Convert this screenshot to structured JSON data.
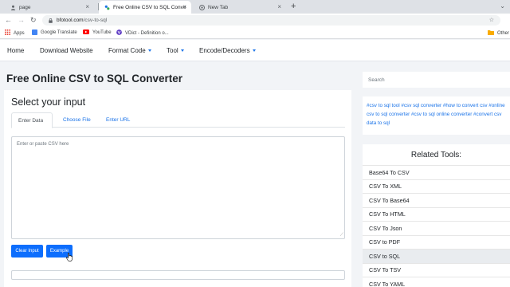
{
  "browser": {
    "tabs": [
      {
        "title": "page"
      },
      {
        "title": "Free Online CSV to SQL Converte"
      },
      {
        "title": "New Tab"
      }
    ],
    "url_domain": "bfotool.com",
    "url_path": "/csv-to-sql",
    "bookmarks": [
      {
        "label": "Apps",
        "color": "#ea4335"
      },
      {
        "label": "Google Translate",
        "color": "#4285f4"
      },
      {
        "label": "YouTube",
        "color": "#ff0000"
      },
      {
        "label": "VDict - Definition o...",
        "color": "#5f3dc4"
      },
      {
        "label": "Other",
        "color": "#f9ab00"
      }
    ]
  },
  "nav": {
    "items": [
      {
        "label": "Home"
      },
      {
        "label": "Download Website"
      },
      {
        "label": "Format Code"
      },
      {
        "label": "Tool"
      },
      {
        "label": "Encode/Decoders"
      }
    ]
  },
  "main": {
    "title": "Free Online CSV to SQL Converter",
    "select_heading": "Select your input",
    "tabs": [
      {
        "label": "Enter Data"
      },
      {
        "label": "Choose File"
      },
      {
        "label": "Enter URL"
      }
    ],
    "textarea_placeholder": "Enter or paste CSV here",
    "clear_label": "Clear Input",
    "example_label": "Example"
  },
  "sidebar": {
    "search_placeholder": "Search",
    "tags": "#csv to sql tool #csv sql converter #how to convert csv #online csv to sql converter #csv to sql online converter #convert csv data to sql",
    "related_title": "Related Tools:",
    "related": [
      {
        "label": "Base64 To CSV"
      },
      {
        "label": "CSV To XML"
      },
      {
        "label": "CSV To Base64"
      },
      {
        "label": "CSV To HTML"
      },
      {
        "label": "CSV To Json"
      },
      {
        "label": "CSV to PDF"
      },
      {
        "label": "CSV to SQL"
      },
      {
        "label": "CSV To TSV"
      },
      {
        "label": "CSV To YAML"
      }
    ]
  },
  "colors": {
    "accent": "#1a73e8",
    "button": "#0d6efd",
    "page_bg": "#f2f4f7"
  }
}
